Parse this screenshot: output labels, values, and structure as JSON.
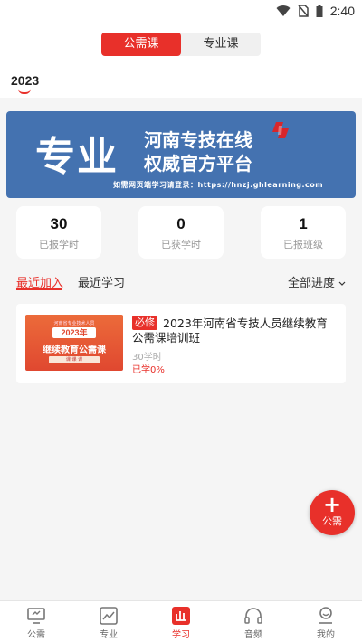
{
  "status_bar": {
    "time": "2:40",
    "icons": [
      "wifi-icon",
      "no-sim-icon",
      "battery-icon"
    ]
  },
  "segment": {
    "tabs": [
      {
        "label": "公需课",
        "active": true
      },
      {
        "label": "专业课",
        "active": false
      }
    ]
  },
  "year_tab": {
    "label": "2023"
  },
  "banner": {
    "big_text": "专业",
    "line1": "河南专技在线",
    "line2": "权威官方平台",
    "url_text": "如需网页端学习请登录：https://hnzj.ghlearning.com"
  },
  "stats": [
    {
      "value": "30",
      "label": "已报学时"
    },
    {
      "value": "0",
      "label": "已获学时"
    },
    {
      "value": "1",
      "label": "已报班级"
    }
  ],
  "list_tabs": {
    "recent_join": "最近加入",
    "recent_study": "最近学习",
    "filter": "全部进度"
  },
  "course": {
    "thumb": {
      "line1": "河南省专业技术人员",
      "year": "2023年",
      "line2": "继续教育公需课",
      "line3": "课 课 课"
    },
    "badge": "必修",
    "title": "2023年河南省专技人员继续教育公需课培训班",
    "hours": "30学时",
    "progress_text": "已学0%",
    "progress": 0
  },
  "fab": {
    "label": "公需"
  },
  "tabbar": [
    {
      "label": "公需",
      "icon": "monitor-icon",
      "active": false
    },
    {
      "label": "专业",
      "icon": "chart-icon",
      "active": false
    },
    {
      "label": "学习",
      "icon": "study-icon",
      "active": true
    },
    {
      "label": "音频",
      "icon": "headphones-icon",
      "active": false
    },
    {
      "label": "我的",
      "icon": "profile-icon",
      "active": false
    }
  ],
  "colors": {
    "accent": "#e8302a",
    "banner": "#4472b0",
    "background": "#f5f5f5"
  }
}
